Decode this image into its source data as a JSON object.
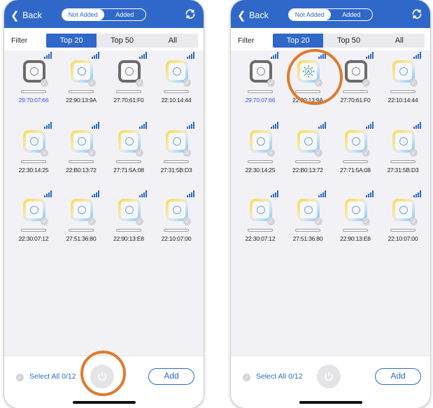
{
  "screens": [
    {
      "header": {
        "back_label": "Back",
        "seg_not_added": "Not Added",
        "seg_added": "Added"
      },
      "filter": {
        "label": "Filter",
        "tabs": [
          "Top 20",
          "Top 50",
          "All"
        ],
        "active_tab": "Top 20"
      },
      "devices": [
        "29:70:07:66",
        "22:90:13:9A",
        "27:70:61:F0",
        "22:10:14:44",
        "22:30:14:25",
        "22:B0:13:72",
        "27:71:5A:08",
        "27:31:5B:D3",
        "22:30:07:12",
        "27:51:36:80",
        "22:90:13:E8",
        "22:10:07:00"
      ],
      "footer": {
        "select_all": "Select All 0/12",
        "add_label": "Add"
      }
    },
    {
      "header": {
        "back_label": "Back",
        "seg_not_added": "Not Added",
        "seg_added": "Added"
      },
      "filter": {
        "label": "Filter",
        "tabs": [
          "Top 20",
          "Top 50",
          "All"
        ],
        "active_tab": "Top 20"
      },
      "devices": [
        "29:70:07:66",
        "22:90:13:9A",
        "27:70:61:F0",
        "22:10:14:44",
        "22:30:14:25",
        "22:B0:13:72",
        "27:71:5A:08",
        "27:31:5B:D3",
        "22:30:07:12",
        "27:51:36:80",
        "22:90:13:E8",
        "22:10:07:00"
      ],
      "footer": {
        "select_all": "Select All 0/12",
        "add_label": "Add"
      }
    }
  ],
  "device_icons": {
    "gray_tiles_left": [
      0,
      2
    ],
    "gray_tiles_right": [
      0,
      2
    ],
    "highlighted_address_index": 0,
    "active_light_tile_right": 1,
    "active_light_letter": "A"
  },
  "annotations": {
    "left": "power-button",
    "right": "device-tile-22:90:13:9A"
  },
  "colors": {
    "brand": "#2f68c8",
    "annotation": "#e07a2b",
    "highlight_text": "#3a55e8"
  }
}
